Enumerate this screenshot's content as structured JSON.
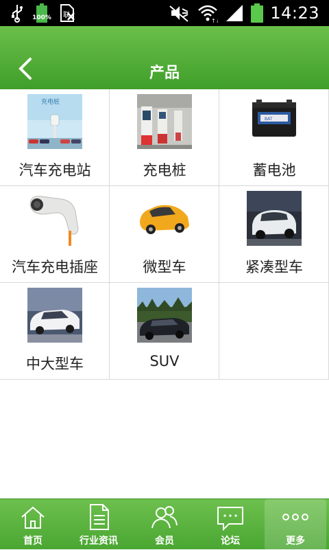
{
  "status_bar": {
    "time": "14:23",
    "battery_percent_label": "100%"
  },
  "header": {
    "title": "产品"
  },
  "products": [
    {
      "label": "汽车充电站",
      "icon": "charging-station-photo"
    },
    {
      "label": "充电桩",
      "icon": "charging-pile-photo"
    },
    {
      "label": "蓄电池",
      "icon": "car-battery-photo"
    },
    {
      "label": "汽车充电插座",
      "icon": "charging-plug-photo"
    },
    {
      "label": "微型车",
      "icon": "mini-car-photo"
    },
    {
      "label": "紧凑型车",
      "icon": "compact-car-photo"
    },
    {
      "label": "中大型车",
      "icon": "large-car-photo"
    },
    {
      "label": "SUV",
      "icon": "suv-photo"
    }
  ],
  "tabbar": {
    "items": [
      {
        "label": "首页",
        "icon": "home-icon"
      },
      {
        "label": "行业资讯",
        "icon": "document-icon"
      },
      {
        "label": "会员",
        "icon": "users-icon"
      },
      {
        "label": "论坛",
        "icon": "chat-icon"
      },
      {
        "label": "更多",
        "icon": "more-icon"
      }
    ],
    "active_index": 4
  },
  "colors": {
    "header_green": "#4fa834",
    "tab_green": "#5bb440",
    "divider": "#d8d8d8"
  }
}
